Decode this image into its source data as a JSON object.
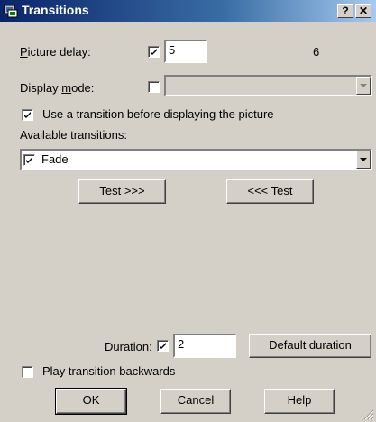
{
  "window": {
    "title": "Transitions",
    "help_button": "?",
    "close_button": "✕"
  },
  "picture_delay": {
    "label": "Picture delay:",
    "checked": true,
    "value": "5",
    "extra_value": "6"
  },
  "display_mode": {
    "label": "Display mode:",
    "checked": false,
    "value": ""
  },
  "use_transition": {
    "label": "Use a transition before displaying the picture",
    "checked": true
  },
  "available_transitions": {
    "label": "Available transitions:",
    "selected": "Fade",
    "checked": true
  },
  "buttons": {
    "test_forward": "Test >>>",
    "test_back": "<<< Test",
    "default_duration": "Default duration",
    "ok": "OK",
    "cancel": "Cancel",
    "help": "Help"
  },
  "duration": {
    "label": "Duration:",
    "checked": true,
    "value": "2"
  },
  "play_backwards": {
    "label": "Play transition backwards",
    "checked": false
  },
  "colors": {
    "titlebar": "#0a246a",
    "face": "#d4d0c8"
  }
}
